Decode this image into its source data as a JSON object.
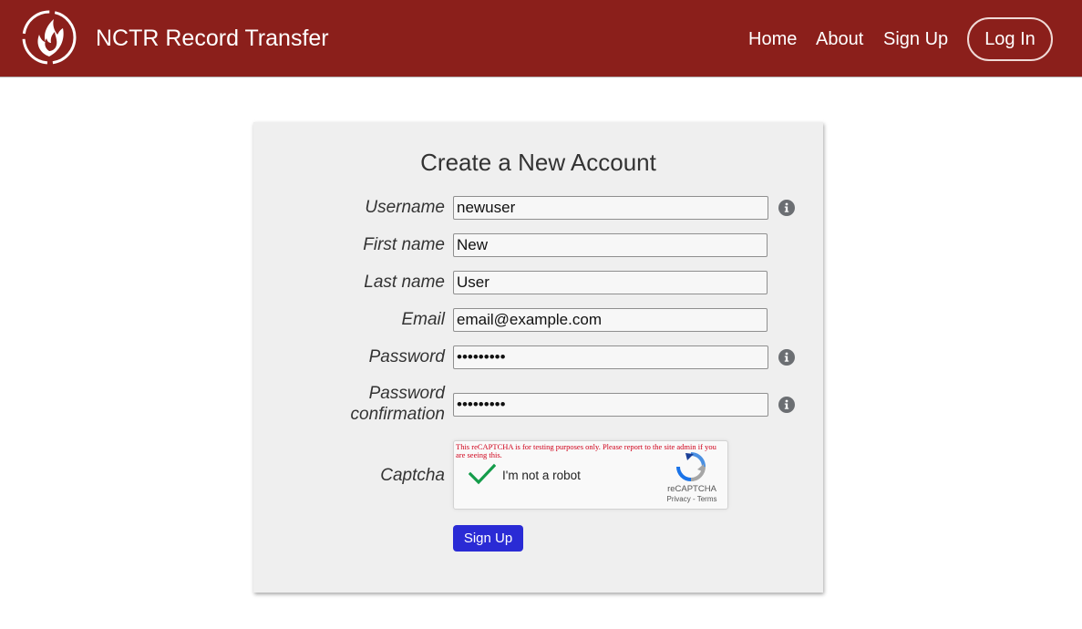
{
  "header": {
    "site_title": "NCTR Record Transfer",
    "nav": {
      "home": "Home",
      "about": "About",
      "sign_up": "Sign Up",
      "log_in": "Log In"
    },
    "background_color": "#8b1f1b"
  },
  "form": {
    "title": "Create a New Account",
    "fields": {
      "username": {
        "label": "Username",
        "value": "newuser"
      },
      "first_name": {
        "label": "First name",
        "value": "New"
      },
      "last_name": {
        "label": "Last name",
        "value": "User"
      },
      "email": {
        "label": "Email",
        "value": "email@example.com"
      },
      "password": {
        "label": "Password",
        "value": "password1"
      },
      "password_confirmation": {
        "label_line1": "Password",
        "label_line2": "confirmation",
        "value": "password1"
      },
      "captcha": {
        "label": "Captcha"
      }
    },
    "recaptcha": {
      "warning": "This reCAPTCHA is for testing purposes only. Please report to the site admin if you are seeing this.",
      "checkbox_label": "I'm not a robot",
      "brand": "reCAPTCHA",
      "links": "Privacy - Terms",
      "checked": true
    },
    "submit_label": "Sign Up",
    "submit_color": "#2a2bd5"
  },
  "icons": {
    "logo": "flame-logo-icon",
    "info": "info-icon",
    "check": "checkmark-icon",
    "recaptcha": "recaptcha-icon"
  }
}
